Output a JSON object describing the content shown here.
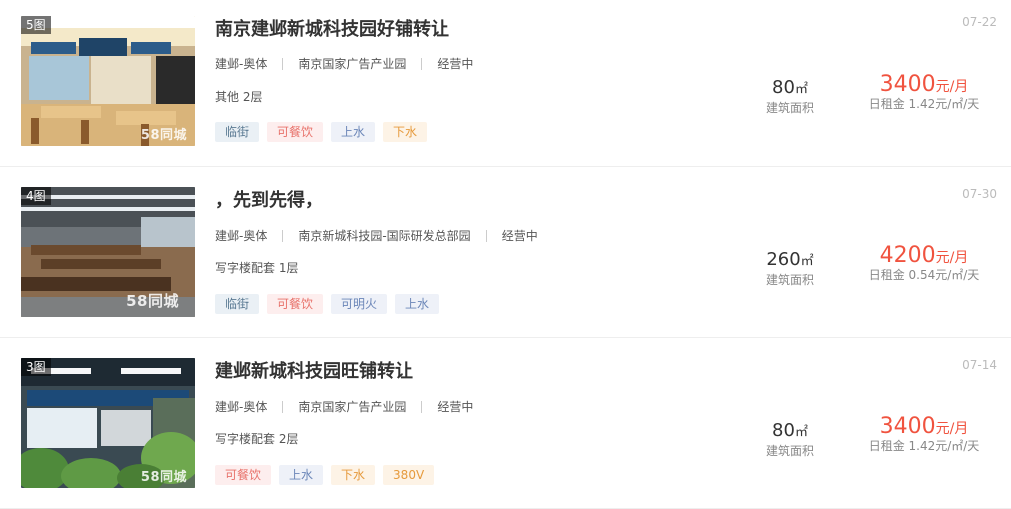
{
  "listings": [
    {
      "photo_count": "5图",
      "watermark": "58同城",
      "title": "南京建邺新城科技园好铺转让",
      "district": "建邺-奥体",
      "location": "南京国家广告产业园",
      "status": "经营中",
      "floor": "其他 2层",
      "tags": [
        "临街",
        "可餐饮",
        "上水",
        "下水"
      ],
      "area_value": "80",
      "area_unit": "㎡",
      "area_label": "建筑面积",
      "price_value": "3400",
      "price_unit": "元/月",
      "daily_rent": "日租金 1.42元/㎡/天",
      "date": "07-22"
    },
    {
      "photo_count": "4图",
      "watermark": "58同城",
      "title": "，先到先得，",
      "district": "建邺-奥体",
      "location": "南京新城科技园-国际研发总部园",
      "status": "经营中",
      "floor": "写字楼配套 1层",
      "tags": [
        "临街",
        "可餐饮",
        "可明火",
        "上水"
      ],
      "area_value": "260",
      "area_unit": "㎡",
      "area_label": "建筑面积",
      "price_value": "4200",
      "price_unit": "元/月",
      "daily_rent": "日租金 0.54元/㎡/天",
      "date": "07-30"
    },
    {
      "photo_count": "3图",
      "watermark": "58同城",
      "title": "建邺新城科技园旺铺转让",
      "district": "建邺-奥体",
      "location": "南京国家广告产业园",
      "status": "经营中",
      "floor": "写字楼配套 2层",
      "tags": [
        "可餐饮",
        "上水",
        "下水",
        "380V"
      ],
      "area_value": "80",
      "area_unit": "㎡",
      "area_label": "建筑面积",
      "price_value": "3400",
      "price_unit": "元/月",
      "daily_rent": "日租金 1.42元/㎡/天",
      "date": "07-14"
    }
  ],
  "tag_styles": {
    "临街": {
      "bg": "#eaf0f5",
      "fg": "#5b7a93"
    },
    "可餐饮": {
      "bg": "#fdeeee",
      "fg": "#e8726b"
    },
    "上水": {
      "bg": "#eef1f8",
      "fg": "#6b86b8"
    },
    "下水": {
      "bg": "#fdf3e6",
      "fg": "#e69a3c"
    },
    "可明火": {
      "bg": "#eef1f8",
      "fg": "#6b86b8"
    },
    "380V": {
      "bg": "#fdf3e6",
      "fg": "#e69a3c"
    }
  },
  "colors": {
    "price": "#f0533f",
    "title": "#333333",
    "muted": "#888888",
    "date": "#bbbbbb"
  },
  "thumb_icons": [
    "restaurant-photo-1",
    "restaurant-photo-2",
    "restaurant-photo-3"
  ]
}
